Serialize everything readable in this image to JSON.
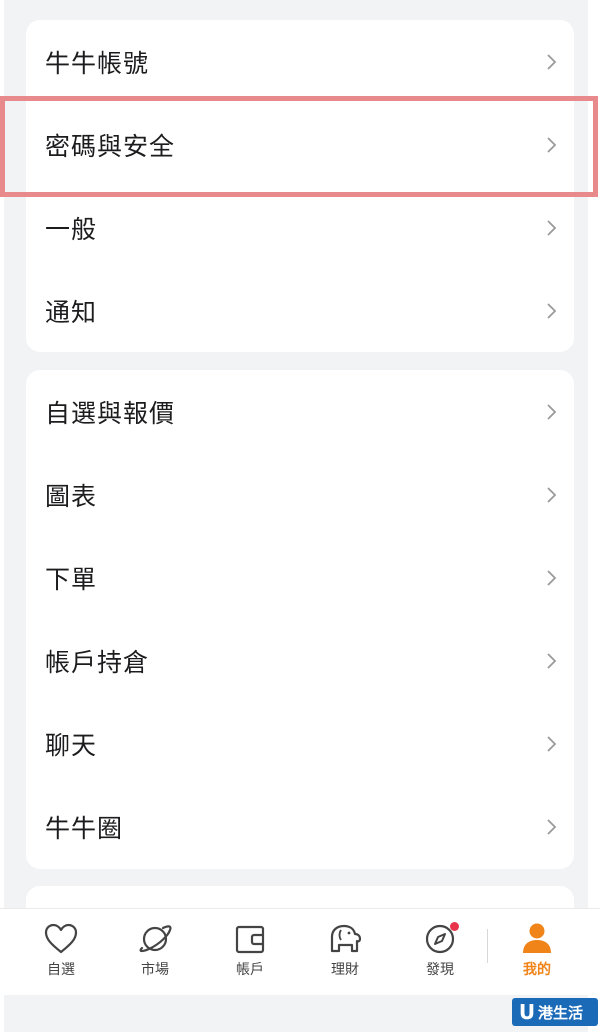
{
  "settings": {
    "group1": [
      {
        "label": "牛牛帳號"
      },
      {
        "label": "密碼與安全"
      },
      {
        "label": "一般"
      },
      {
        "label": "通知"
      }
    ],
    "group2": [
      {
        "label": "自選與報價"
      },
      {
        "label": "圖表"
      },
      {
        "label": "下單"
      },
      {
        "label": "帳戶持倉"
      },
      {
        "label": "聊天"
      },
      {
        "label": "牛牛圈"
      }
    ]
  },
  "tabbar": {
    "tabs": [
      {
        "label": "自選",
        "icon": "heart-icon"
      },
      {
        "label": "市場",
        "icon": "planet-icon"
      },
      {
        "label": "帳戶",
        "icon": "wallet-icon"
      },
      {
        "label": "理財",
        "icon": "elephant-icon"
      },
      {
        "label": "發現",
        "icon": "compass-icon"
      },
      {
        "label": "我的",
        "icon": "person-icon"
      }
    ],
    "active_index": 5
  },
  "watermark": {
    "logo_letter": "U",
    "text": "港生活"
  },
  "colors": {
    "accent": "#f08419",
    "highlight_border": "#e88a8c",
    "badge": "#e8344a"
  }
}
